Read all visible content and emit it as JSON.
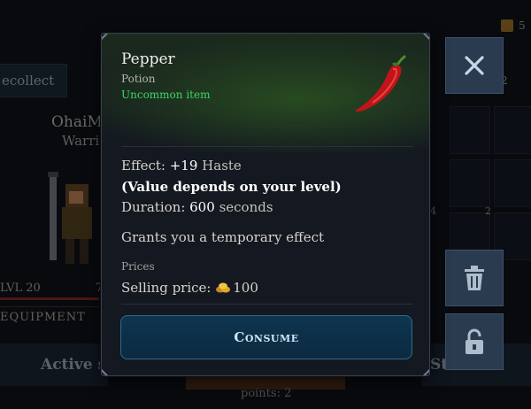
{
  "background": {
    "collect_label": "ecollect",
    "hero_name": "OhaiM",
    "hero_class": "Warri",
    "level_label": "LVL 20",
    "level_side": "7",
    "equipment_tab": "EQUIPMENT",
    "active_tab": "Active s",
    "right_tab": "Sta",
    "points_label": "points: 2",
    "top_count": "5",
    "side_count": "2",
    "grid_counts": [
      "4",
      "2"
    ]
  },
  "item": {
    "name": "Pepper",
    "type": "Potion",
    "rarity": "Uncommon item",
    "rarity_color": "#3fd36a",
    "icon": "red-chili-pepper-icon"
  },
  "stats": {
    "effect_prefix": "Effect: ",
    "effect_value": "+19",
    "effect_stat": "Haste",
    "note": "(Value depends on your level)",
    "duration_prefix": "Duration: ",
    "duration_value": "600",
    "duration_unit": "seconds",
    "description": "Grants you a temporary effect"
  },
  "prices": {
    "section_label": "Prices",
    "selling_label": "Selling price: ",
    "selling_value": "100",
    "currency_icon": "gold-coins-icon"
  },
  "actions": {
    "consume_label": "Consume",
    "close_icon": "close-icon",
    "delete_icon": "trash-icon",
    "lock_icon": "unlock-icon"
  }
}
